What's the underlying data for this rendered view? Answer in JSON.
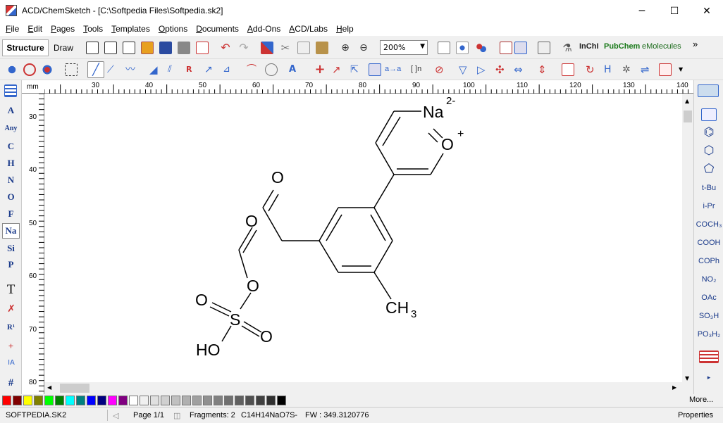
{
  "window": {
    "title": "ACD/ChemSketch - [C:\\Softpedia Files\\Softpedia.sk2]",
    "minimize": "─",
    "maximize": "☐",
    "close": "✕"
  },
  "menu": [
    "File",
    "Edit",
    "Pages",
    "Tools",
    "Templates",
    "Options",
    "Documents",
    "Add-Ons",
    "ACD/Labs",
    "Help"
  ],
  "toolbar": {
    "structure_label": "Structure",
    "draw_label": "Draw",
    "zoom_value": "200%",
    "inchi_label": "InChI",
    "pubchem_label": "PubChem",
    "emolecules_label": "eMolecules",
    "more_glyph": "»",
    "atom_label_button": "a→a",
    "bracket_button": "[ ]n"
  },
  "atoms_panel": [
    "A",
    "Any",
    "C",
    "H",
    "N",
    "O",
    "F",
    "Na",
    "Si",
    "P",
    "T",
    "R¹",
    "+",
    "#"
  ],
  "atoms_selected": "Na",
  "templates_panel": [
    "t-Bu",
    "i-Pr",
    "COCH₃",
    "COOH",
    "COPh",
    "NO₂",
    "OAc",
    "SO₃H",
    "PO₃H₂"
  ],
  "ruler": {
    "unit": "mm",
    "h_labels": [
      "30",
      "40",
      "50",
      "60",
      "70",
      "80",
      "90",
      "100",
      "110",
      "120",
      "130",
      "140"
    ],
    "v_labels": [
      "30",
      "40",
      "50",
      "60",
      "70",
      "80"
    ]
  },
  "molecule": {
    "na_label": "Na",
    "na_charge": "2-",
    "ring_o_label": "O",
    "ring_o_charge": "+",
    "ketone_o": "O",
    "ester_carbonyl_o": "O",
    "ester_o": "O",
    "sulfonyl_o1": "O",
    "sulfonyl_o2": "O",
    "sulfur": "S",
    "hydroxyl": "HO",
    "methyl": "CH",
    "methyl_sub": "3"
  },
  "colors": [
    "#ff0000",
    "#800000",
    "#ffff00",
    "#808000",
    "#00ff00",
    "#008000",
    "#00ffff",
    "#008080",
    "#0000ff",
    "#000080",
    "#ff00ff",
    "#800080",
    "#ffffff",
    "#f0f0f0",
    "#e0e0e0",
    "#d0d0d0",
    "#c0c0c0",
    "#b0b0b0",
    "#a0a0a0",
    "#909090",
    "#808080",
    "#707070",
    "#606060",
    "#505050",
    "#404040",
    "#303030",
    "#000000"
  ],
  "colorbar": {
    "more_label": "More..."
  },
  "status": {
    "filename": "SOFTPEDIA.SK2",
    "page": "Page 1/1",
    "fragments": "Fragments: 2",
    "formula": "C14H14NaO7S-",
    "fw": "FW : 349.3120776",
    "properties": "Properties"
  }
}
